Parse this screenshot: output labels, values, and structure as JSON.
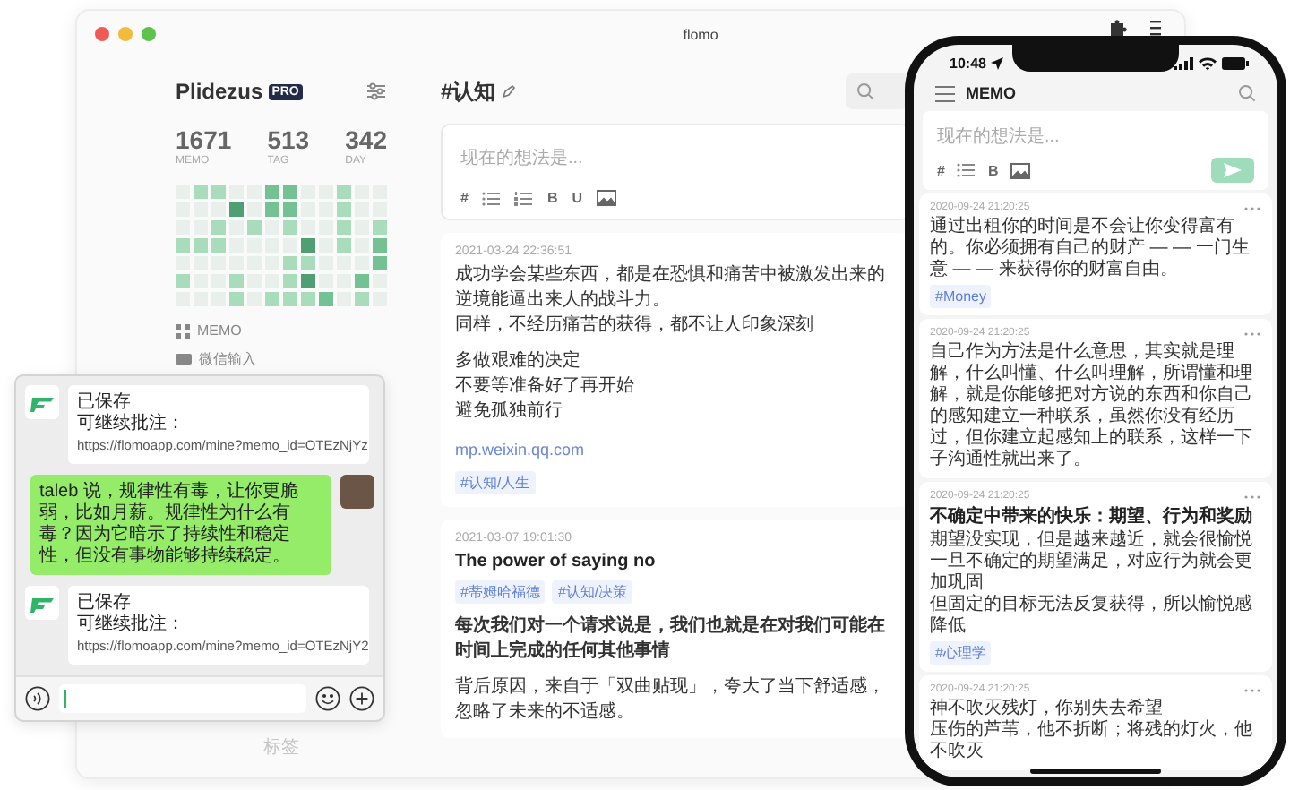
{
  "desktop_window": {
    "title": "flomo",
    "sidebar": {
      "user": "Plidezus",
      "badge": "PRO",
      "stats": [
        {
          "value": "1671",
          "label": "MEMO"
        },
        {
          "value": "513",
          "label": "TAG"
        },
        {
          "value": "342",
          "label": "DAY"
        }
      ],
      "nav": [
        {
          "label": "MEMO",
          "kind": "grid"
        },
        {
          "label": "微信输入",
          "kind": "chat"
        }
      ],
      "footer": "标签"
    },
    "main": {
      "heading": "#认知",
      "editor": {
        "placeholder": "现在的想法是...",
        "toolbar": [
          {
            "kind": "glyph",
            "text": "#"
          },
          {
            "kind": "bullets"
          },
          {
            "kind": "numbers"
          },
          {
            "kind": "glyph",
            "text": "B"
          },
          {
            "kind": "glyph",
            "text": "U"
          },
          {
            "kind": "image"
          }
        ]
      },
      "memos": [
        {
          "date": "2021-03-24 22:36:51",
          "blocks": [
            {
              "kind": "text",
              "lines": [
                "成功学会某些东西，都是在恐惧和痛苦中被激发出来的",
                "逆境能逼出来人的战斗力。",
                "同样，不经历痛苦的获得，都不让人印象深刻"
              ]
            },
            {
              "kind": "text",
              "lines": [
                "多做艰难的决定",
                "不要等准备好了再开始",
                "避免孤独前行"
              ]
            },
            {
              "kind": "link",
              "text": "mp.weixin.qq.com"
            },
            {
              "kind": "tags",
              "tags": [
                "#认知/人生"
              ]
            }
          ]
        },
        {
          "date": "2021-03-07 19:01:30",
          "blocks": [
            {
              "kind": "title",
              "text": "The power of saying no"
            },
            {
              "kind": "tags",
              "tags": [
                "#蒂姆哈福德",
                "#认知/决策"
              ]
            },
            {
              "kind": "bold",
              "lines": [
                "每次我们对一个请求说是，我们也就是在对我们可能在时间上完成的任何其他事情"
              ]
            },
            {
              "kind": "text",
              "lines": [
                "背后原因，来自于「双曲贴现」，夸大了当下舒适感，忽略了未来的不适感。"
              ]
            }
          ]
        }
      ]
    }
  },
  "chat": {
    "messages": [
      {
        "kind": "bot",
        "title": "已保存",
        "label": "可继续批注：",
        "link": "https://flomoapp.com/mine?memo_id=OTEzNjYz"
      },
      {
        "kind": "user",
        "text": "taleb 说，规律性有毒，让你更脆弱，比如月薪。规律性为什么有毒？因为它暗示了持续性和稳定性，但没有事物能够持续稳定。"
      },
      {
        "kind": "bot",
        "title": "已保存",
        "label": "可继续批注：",
        "link": "https://flomoapp.com/mine?memo_id=OTEzNjY2"
      }
    ]
  },
  "phone": {
    "time": "10:48",
    "title": "MEMO",
    "editor": {
      "placeholder": "现在的想法是...",
      "toolbar": [
        {
          "kind": "glyph",
          "text": "#"
        },
        {
          "kind": "bullets"
        },
        {
          "kind": "glyph",
          "text": "B"
        },
        {
          "kind": "image"
        }
      ]
    },
    "memos": [
      {
        "date": "2020-09-24 21:20:25",
        "blocks": [
          {
            "kind": "text",
            "lines": [
              "通过出租你的时间是不会让你变得富有的。你必须拥有自己的财产 — — 一门生意 — — 来获得你的财富自由。"
            ],
            "tag": "#Money"
          }
        ]
      },
      {
        "date": "2020-09-24 21:20:25",
        "blocks": [
          {
            "kind": "text",
            "lines": [
              "自己作为方法是什么意思，其实就是理解，什么叫懂、什么叫理解，所谓懂和理解，就是你能够把对方说的东西和你自己的感知建立一种联系，虽然你没有经历过，但你建立起感知上的联系，这样一下子沟通性就出来了。"
            ]
          }
        ]
      },
      {
        "date": "2020-09-24 21:20:25",
        "blocks": [
          {
            "kind": "title",
            "text": "不确定中带来的快乐：期望、行为和奖励"
          },
          {
            "kind": "text",
            "lines": [
              "期望没实现，但是越来越近，就会很愉悦",
              "一旦不确定的期望满足，对应行为就会更加巩固",
              "但固定的目标无法反复获得，所以愉悦感降低"
            ]
          },
          {
            "kind": "tags",
            "tags": [
              "#心理学"
            ]
          }
        ]
      },
      {
        "date": "2020-09-24 21:20:25",
        "blocks": [
          {
            "kind": "text",
            "lines": [
              "神不吹灭残灯，你别失去希望",
              "压伤的芦苇，他不折断；将残的灯火，他不吹灭"
            ]
          }
        ]
      }
    ]
  }
}
